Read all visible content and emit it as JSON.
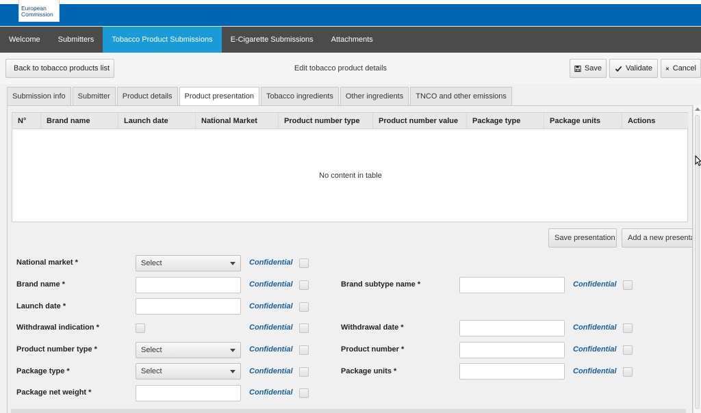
{
  "branding": {
    "logo_line1": "European",
    "logo_line2": "Commission"
  },
  "nav": {
    "items": [
      "Welcome",
      "Submitters",
      "Tobacco Product Submissions",
      "E-Cigarette Submissions",
      "Attachments"
    ],
    "active_index": 2
  },
  "toolbar": {
    "back_label": "Back to tobacco products list",
    "title": "Edit tobacco product details",
    "save_label": "Save",
    "validate_label": "Validate",
    "cancel_label": "Cancel"
  },
  "tabs": {
    "items": [
      "Submission info",
      "Submitter",
      "Product details",
      "Product presentation",
      "Tobacco ingredients",
      "Other ingredients",
      "TNCO and other emissions"
    ],
    "active_index": 3
  },
  "table": {
    "columns": [
      "N°",
      "Brand name",
      "Launch date",
      "National Market",
      "Product number type",
      "Product number value",
      "Package type",
      "Package units",
      "Actions"
    ],
    "empty_message": "No content in table"
  },
  "actions": {
    "save_presentation": "Save presentation",
    "add_presentation": "Add a new presentation"
  },
  "form": {
    "confidential_label": "Confidential",
    "select_placeholder": "Select",
    "national_market": "National market *",
    "brand_name": "Brand name *",
    "brand_subtype_name": "Brand subtype name *",
    "launch_date": "Launch date *",
    "withdrawal_indication": "Withdrawal indication *",
    "withdrawal_date": "Withdrawal date *",
    "product_number_type": "Product number type *",
    "product_number": "Product number *",
    "package_type": "Package type *",
    "package_units": "Package units *",
    "package_net_weight": "Package net weight *"
  },
  "colors": {
    "header_blue": "#0066b3",
    "nav_dark": "#4b4b4b",
    "nav_active": "#1a9ad6",
    "confidential_text": "#1a5f96"
  }
}
